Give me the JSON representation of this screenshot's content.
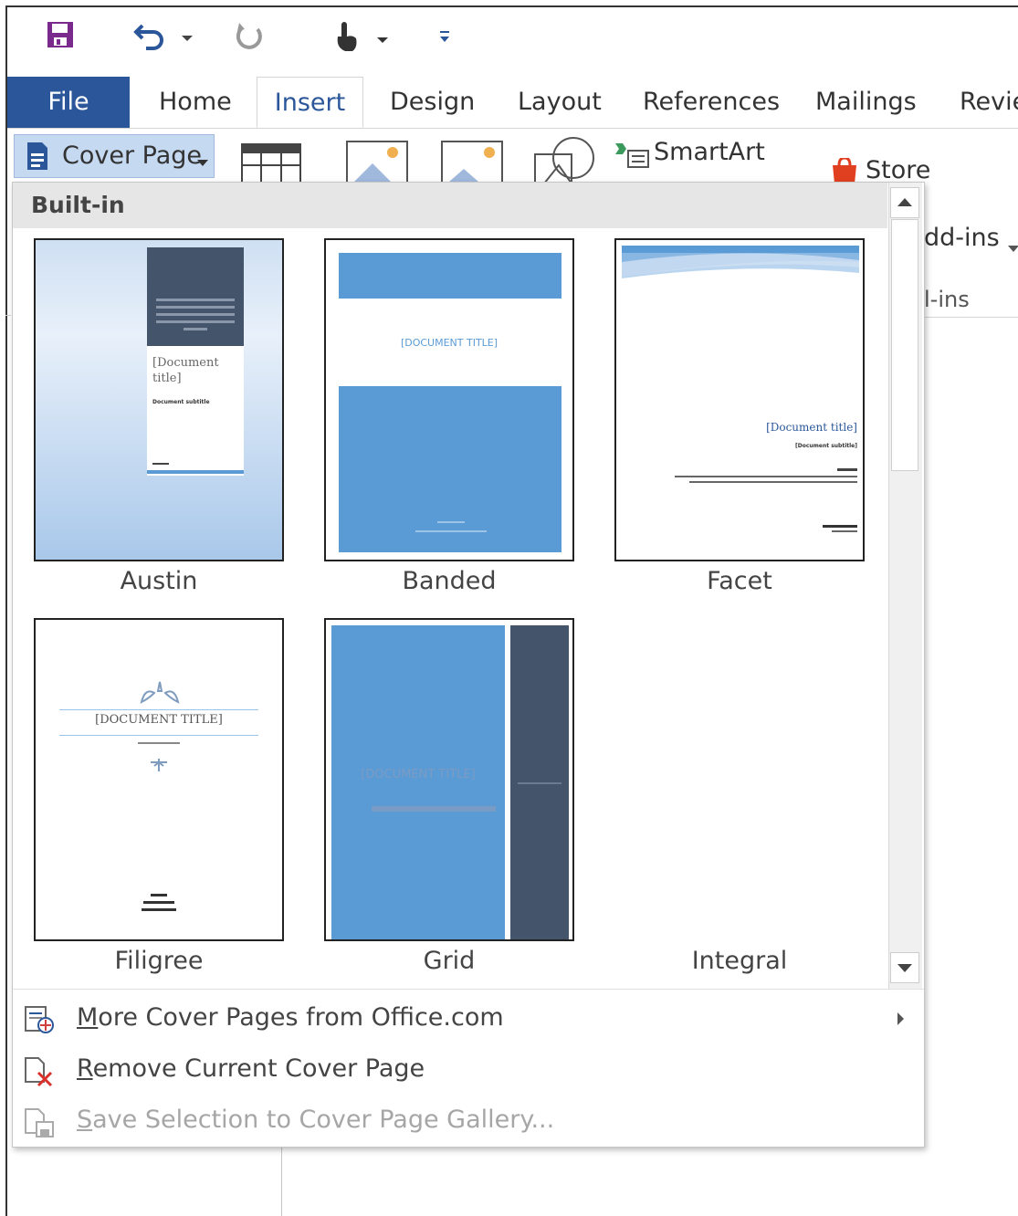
{
  "qat": {
    "icons": [
      "save-icon",
      "undo-icon",
      "redo-icon",
      "touch-mode-icon",
      "customize-icon"
    ]
  },
  "tabs": [
    {
      "label": "File"
    },
    {
      "label": "Home"
    },
    {
      "label": "Insert"
    },
    {
      "label": "Design"
    },
    {
      "label": "Layout"
    },
    {
      "label": "References"
    },
    {
      "label": "Mailings"
    },
    {
      "label": "Revie"
    }
  ],
  "ribbon": {
    "cover_page_label": "Cover Page",
    "smartart_label": "SmartArt",
    "store_label": "Store",
    "addins_label": "dd-ins",
    "addins_group_label": "l-ins"
  },
  "gallery": {
    "section_title": "Built-in",
    "items": [
      {
        "label": "Austin",
        "title_text": "[Document title]",
        "subtitle_text": "Document subtitle"
      },
      {
        "label": "Banded",
        "title_text": "[DOCUMENT TITLE]"
      },
      {
        "label": "Facet",
        "title_text": "[Document title]",
        "subtitle_text": "[Document subtitle]"
      },
      {
        "label": "Filigree",
        "title_text": "[DOCUMENT TITLE]"
      },
      {
        "label": "Grid",
        "title_text": "[DOCUMENT TITLE]"
      },
      {
        "label": "Integral"
      }
    ]
  },
  "menu": {
    "more": {
      "prefix": "",
      "accel": "M",
      "rest": "ore Cover Pages from Office.com"
    },
    "remove": {
      "accel": "R",
      "rest": "emove Current Cover Page"
    },
    "save": {
      "accel": "S",
      "rest": "ave Selection to Cover Page Gallery..."
    }
  },
  "colors": {
    "file_tab": "#2b579a",
    "accent_blue": "#5b9bd5",
    "dark_slate": "#44546a",
    "selected_button": "#c5d9f1"
  }
}
